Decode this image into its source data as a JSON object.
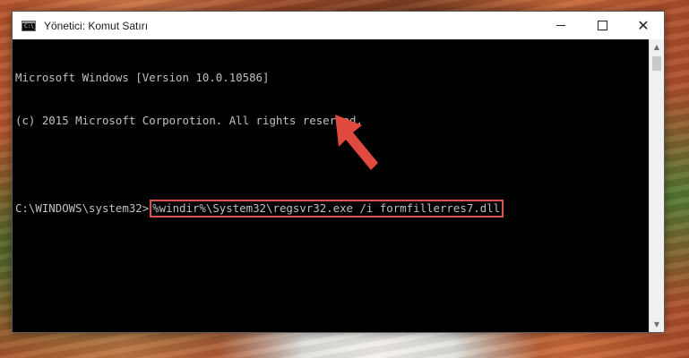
{
  "window": {
    "title": "Yönetici: Komut Satırı",
    "icon": "cmd-icon",
    "icon_text": "C:\\_"
  },
  "controls": {
    "minimize": "minimize-icon",
    "maximize": "maximize-icon",
    "close": "close-icon",
    "close_glyph": "✕"
  },
  "console": {
    "line1": "Microsoft Windows [Version 10.0.10586]",
    "line2": "(c) 2015 Microsoft Corporotion. All rights reserved.",
    "prompt": "C:\\WINDOWS\\system32>",
    "command": "%windir%\\System32\\regsvr32.exe /i formfillerres7.dll"
  },
  "colors": {
    "highlight": "#d9534f",
    "arrow": "#e04a3f"
  },
  "icons": {
    "scroll_up": "▲",
    "scroll_down": "▼"
  }
}
